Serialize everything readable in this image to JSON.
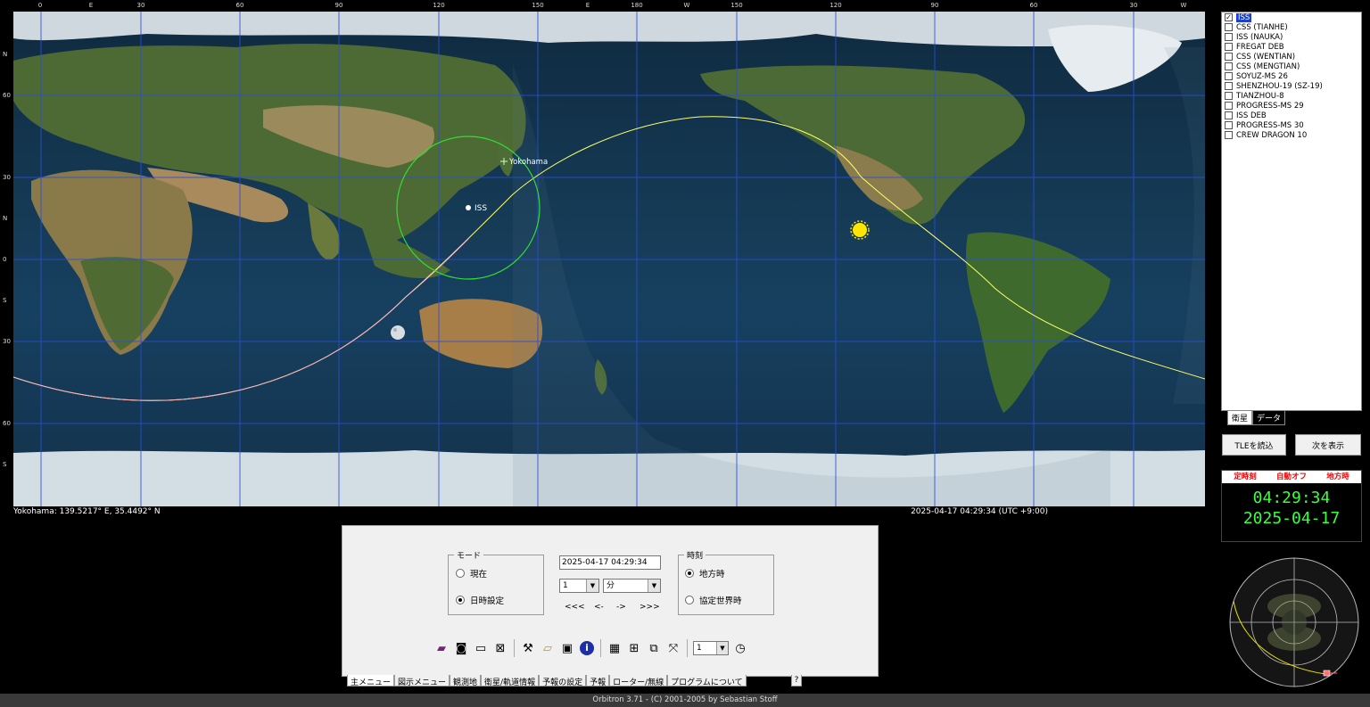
{
  "map": {
    "top_scale": [
      "0",
      "E",
      "30",
      "60",
      "90",
      "120",
      "150",
      "E",
      "180",
      "W",
      "150",
      "120",
      "90",
      "60",
      "30",
      "W"
    ],
    "left_scale": [
      "N",
      "60",
      "30",
      "N",
      "0",
      "S",
      "30",
      "60",
      "S"
    ],
    "labels": {
      "yokohama": "Yokohama",
      "iss": "ISS"
    },
    "status_left": "Yokohama: 139.5217°  E, 35.4492°  N",
    "status_right": "2025-04-17 04:29:34 (UTC +9:00)"
  },
  "satellites": [
    {
      "name": "ISS",
      "checked": true,
      "selected": true
    },
    {
      "name": "CSS (TIANHE)",
      "checked": false
    },
    {
      "name": "ISS (NAUKA)",
      "checked": false
    },
    {
      "name": "FREGAT DEB",
      "checked": false
    },
    {
      "name": "CSS (WENTIAN)",
      "checked": false
    },
    {
      "name": "CSS (MENGTIAN)",
      "checked": false
    },
    {
      "name": "SOYUZ-MS 26",
      "checked": false
    },
    {
      "name": "SHENZHOU-19 (SZ-19)",
      "checked": false
    },
    {
      "name": "TIANZHOU-8",
      "checked": false
    },
    {
      "name": "PROGRESS-MS 29",
      "checked": false
    },
    {
      "name": "ISS DEB",
      "checked": false
    },
    {
      "name": "PROGRESS-MS 30",
      "checked": false
    },
    {
      "name": "CREW DRAGON 10",
      "checked": false
    }
  ],
  "sat_tabs": [
    "衛星",
    "データ"
  ],
  "right_buttons": {
    "load_tle": "TLEを読込",
    "show_next": "次を表示"
  },
  "clock": {
    "header": [
      "定時刻",
      "自動オフ",
      "地方時"
    ],
    "time": "04:29:34",
    "date": "2025-04-17"
  },
  "control": {
    "mode_legend": "モード",
    "mode_now": "現在",
    "mode_set": "日時設定",
    "datetime": "2025-04-17 04:29:34",
    "step_value": "1",
    "step_unit": "分",
    "steps": [
      "<<<",
      "<-",
      "->",
      ">>>"
    ],
    "time_legend": "時刻",
    "time_local": "地方時",
    "time_utc": "協定世界時",
    "speed_value": "1"
  },
  "tabs": [
    "主メニュー",
    "図示メニュー",
    "観測地",
    "衛星/軌道情報",
    "予報の設定",
    "予報",
    "ローター/無線",
    "プログラムについて",
    "?"
  ],
  "footer": "Orbitron 3.71 - (C) 2001-2005 by Sebastian Stoff"
}
